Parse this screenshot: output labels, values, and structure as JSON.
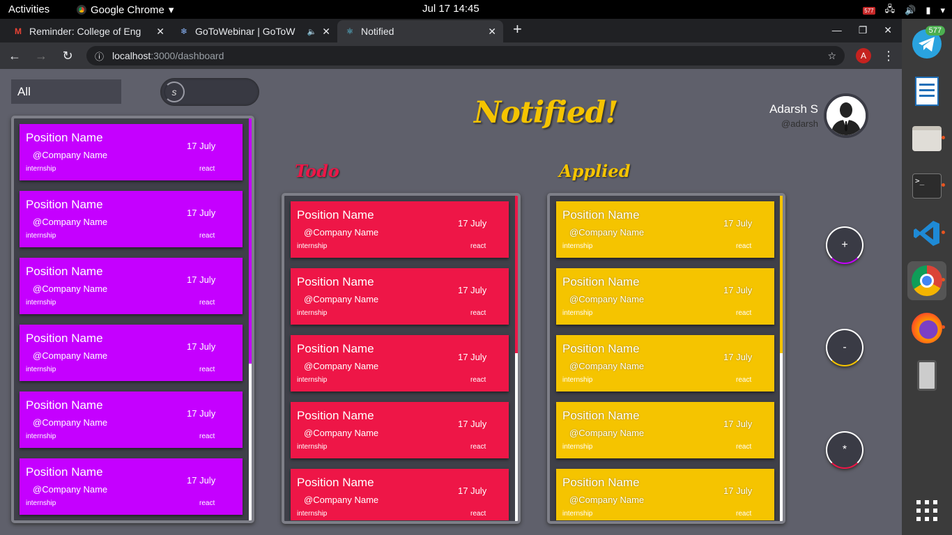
{
  "os": {
    "activities": "Activities",
    "app_name": "Google Chrome",
    "clock": "Jul 17  14:45",
    "tray_badge": "577"
  },
  "browser": {
    "tabs": [
      {
        "title": "Reminder: College of Eng",
        "icon": "gmail-icon"
      },
      {
        "title": "GoToWebinar | GoToW",
        "icon": "webinar-icon"
      },
      {
        "title": "Notified",
        "icon": "react-icon"
      }
    ],
    "url_host": "localhost",
    "url_path": ":3000/dashboard",
    "profile_initial": "A"
  },
  "dock": {
    "telegram_badge": "577"
  },
  "app": {
    "filter_value": "All",
    "search_letter": "s",
    "brand": "Notified!",
    "user_name": "Adarsh S",
    "user_handle": "@adarsh",
    "columns": {
      "todo": "Todo",
      "applied": "Applied"
    },
    "buttons": {
      "add": "+",
      "remove": "-",
      "all": "*"
    },
    "colors": {
      "purple": "#c500ff",
      "red": "#ee1647",
      "yellow": "#f5c400"
    }
  },
  "cards": {
    "all": [
      {
        "position": "Position Name",
        "company": "@Company Name",
        "date": "17 July",
        "type": "internship",
        "tag": "react"
      },
      {
        "position": "Position Name",
        "company": "@Company Name",
        "date": "17 July",
        "type": "internship",
        "tag": "react"
      },
      {
        "position": "Position Name",
        "company": "@Company Name",
        "date": "17 July",
        "type": "internship",
        "tag": "react"
      },
      {
        "position": "Position Name",
        "company": "@Company Name",
        "date": "17 July",
        "type": "internship",
        "tag": "react"
      },
      {
        "position": "Position Name",
        "company": "@Company Name",
        "date": "17 July",
        "type": "internship",
        "tag": "react"
      },
      {
        "position": "Position Name",
        "company": "@Company Name",
        "date": "17 July",
        "type": "internship",
        "tag": "react"
      }
    ],
    "todo": [
      {
        "position": "Position Name",
        "company": "@Company Name",
        "date": "17 July",
        "type": "internship",
        "tag": "react"
      },
      {
        "position": "Position Name",
        "company": "@Company Name",
        "date": "17 July",
        "type": "internship",
        "tag": "react"
      },
      {
        "position": "Position Name",
        "company": "@Company Name",
        "date": "17 July",
        "type": "internship",
        "tag": "react"
      },
      {
        "position": "Position Name",
        "company": "@Company Name",
        "date": "17 July",
        "type": "internship",
        "tag": "react"
      },
      {
        "position": "Position Name",
        "company": "@Company Name",
        "date": "17 July",
        "type": "internship",
        "tag": "react"
      }
    ],
    "applied": [
      {
        "position": "Position Name",
        "company": "@Company Name",
        "date": "17 July",
        "type": "internship",
        "tag": "react"
      },
      {
        "position": "Position Name",
        "company": "@Company Name",
        "date": "17 July",
        "type": "internship",
        "tag": "react"
      },
      {
        "position": "Position Name",
        "company": "@Company Name",
        "date": "17 July",
        "type": "internship",
        "tag": "react"
      },
      {
        "position": "Position Name",
        "company": "@Company Name",
        "date": "17 July",
        "type": "internship",
        "tag": "react"
      },
      {
        "position": "Position Name",
        "company": "@Company Name",
        "date": "17 July",
        "type": "internship",
        "tag": "react"
      }
    ]
  }
}
